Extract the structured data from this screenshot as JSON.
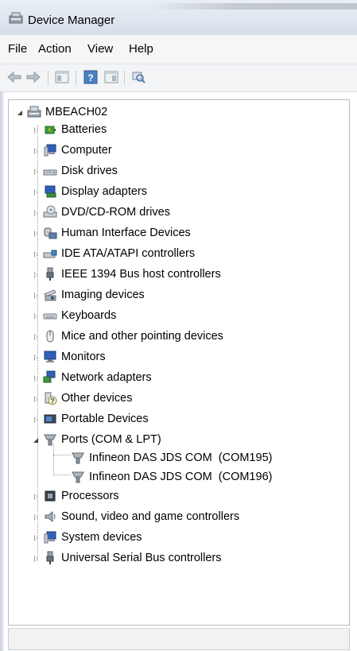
{
  "window": {
    "title": "Device Manager"
  },
  "menu": [
    "File",
    "Action",
    "View",
    "Help"
  ],
  "toolbar": {
    "buttons": [
      "back-arrow-icon",
      "forward-arrow-icon",
      "show-hide-console-tree-icon",
      "help-icon",
      "properties-icon",
      "scan-hardware-changes-icon"
    ]
  },
  "tree": {
    "root": "MBEACH02",
    "items": [
      {
        "label": "Batteries",
        "icon": "battery-icon"
      },
      {
        "label": "Computer",
        "icon": "computer-icon"
      },
      {
        "label": "Disk drives",
        "icon": "disk-drive-icon"
      },
      {
        "label": "Display adapters",
        "icon": "display-adapter-icon"
      },
      {
        "label": "DVD/CD-ROM drives",
        "icon": "dvd-drive-icon"
      },
      {
        "label": "Human Interface Devices",
        "icon": "hid-icon"
      },
      {
        "label": "IDE ATA/ATAPI controllers",
        "icon": "ide-controller-icon"
      },
      {
        "label": "IEEE 1394 Bus host controllers",
        "icon": "ieee1394-icon"
      },
      {
        "label": "Imaging devices",
        "icon": "imaging-device-icon"
      },
      {
        "label": "Keyboards",
        "icon": "keyboard-icon"
      },
      {
        "label": "Mice and other pointing devices",
        "icon": "mouse-icon"
      },
      {
        "label": "Monitors",
        "icon": "monitor-icon"
      },
      {
        "label": "Network adapters",
        "icon": "network-adapter-icon"
      },
      {
        "label": "Other devices",
        "icon": "unknown-device-icon"
      },
      {
        "label": "Portable Devices",
        "icon": "portable-device-icon"
      },
      {
        "label": "Ports (COM & LPT)",
        "icon": "port-icon",
        "expanded": true,
        "children": [
          {
            "label": "Infineon DAS JDS COM  (COM195)",
            "icon": "port-icon"
          },
          {
            "label": "Infineon DAS JDS COM  (COM196)",
            "icon": "port-icon"
          }
        ]
      },
      {
        "label": "Processors",
        "icon": "processor-icon"
      },
      {
        "label": "Sound, video and game controllers",
        "icon": "sound-icon"
      },
      {
        "label": "System devices",
        "icon": "system-device-icon"
      },
      {
        "label": "Universal Serial Bus controllers",
        "icon": "usb-icon"
      }
    ]
  },
  "status": {
    "text": ""
  }
}
